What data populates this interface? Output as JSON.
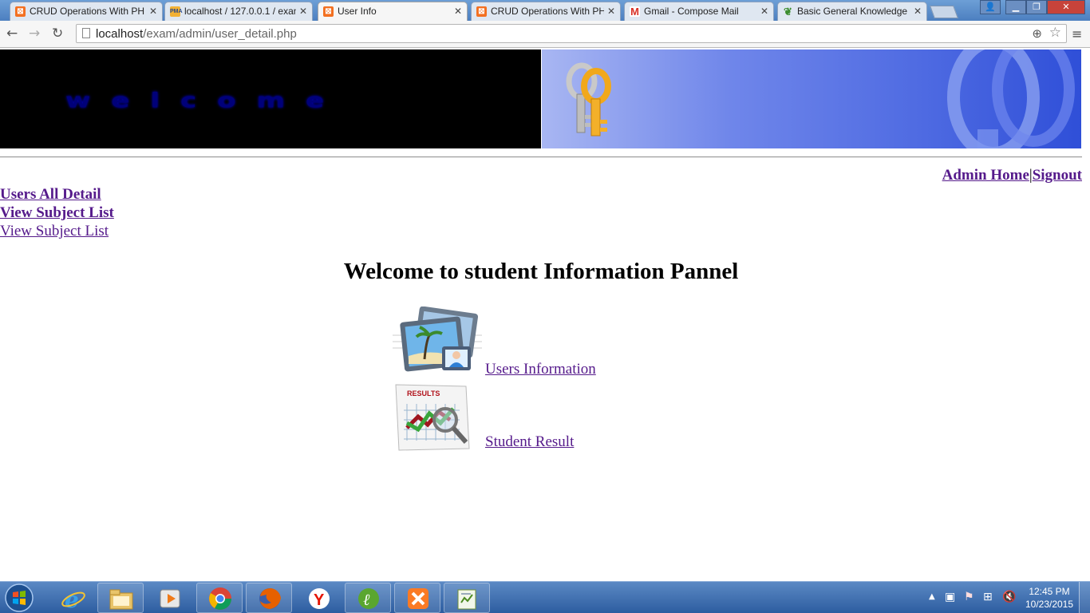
{
  "browser": {
    "tabs": [
      {
        "title": "CRUD Operations With PH",
        "favicon": "xampp-icon",
        "active": false
      },
      {
        "title": "localhost / 127.0.0.1 / exam",
        "favicon": "phpmyadmin-icon",
        "active": false
      },
      {
        "title": "User Info",
        "favicon": "xampp-icon",
        "active": true
      },
      {
        "title": "CRUD Operations With PH",
        "favicon": "xampp-icon",
        "active": false
      },
      {
        "title": "Gmail - Compose Mail",
        "favicon": "gmail-icon",
        "active": false
      },
      {
        "title": "Basic General Knowledge",
        "favicon": "leaf-icon",
        "active": false
      }
    ],
    "url_host": "localhost",
    "url_path": "/exam/admin/user_detail.php"
  },
  "page": {
    "admin_home": "Admin Home",
    "separator": "|",
    "signout": "Signout",
    "side_links": [
      "Users All Detail",
      "View Subject List",
      "View Subject List"
    ],
    "heading": "Welcome to student Information Pannel",
    "items": [
      {
        "label": "Users Information",
        "icon": "users-information-icon"
      },
      {
        "label": "Student Result",
        "icon": "results-chart-icon"
      }
    ]
  },
  "taskbar": {
    "time": "12:45 PM",
    "date": "10/23/2015",
    "apps": [
      "internet-explorer",
      "file-explorer",
      "media-player",
      "chrome",
      "firefox",
      "yandex",
      "dreamweaver",
      "xampp",
      "notepad"
    ]
  }
}
